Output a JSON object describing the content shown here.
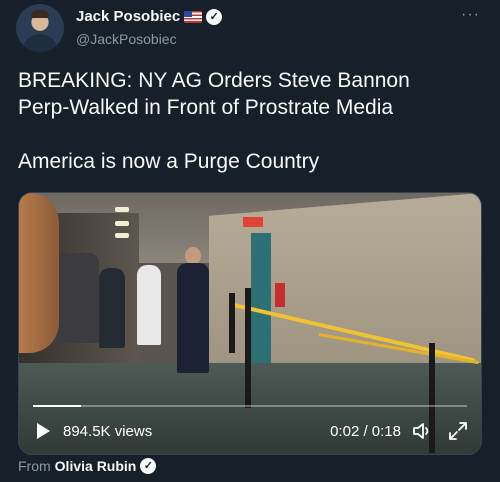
{
  "author": {
    "name": "Jack Posobiec",
    "handle": "@JackPosobiec",
    "badge_icon": "us-flag-icon",
    "verified_icon": "verified-badge-icon"
  },
  "more_label": "···",
  "tweet": {
    "text": "BREAKING: NY AG Orders Steve Bannon\nPerp-Walked in Front of Prostrate Media\n\nAmerica is now a Purge Country"
  },
  "video": {
    "views": "894.5K views",
    "time": "0:02 / 0:18",
    "progress": 0.11
  },
  "source": {
    "prefix": "From",
    "name": "Olivia Rubin"
  },
  "colors": {
    "background": "#15202b",
    "text": "#f7f9f9",
    "secondary": "#8b98a5"
  }
}
